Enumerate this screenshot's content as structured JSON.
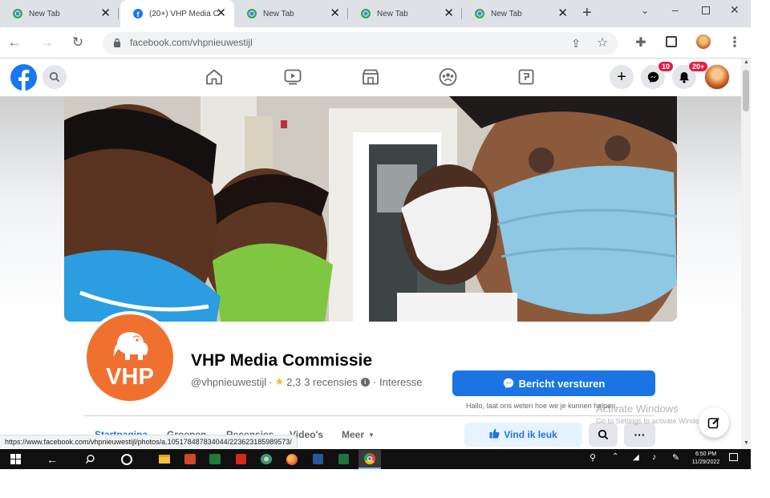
{
  "browser": {
    "tabs": [
      {
        "title": "New Tab"
      },
      {
        "title": "(20+) VHP Media C"
      },
      {
        "title": "New Tab"
      },
      {
        "title": "New Tab"
      },
      {
        "title": "New Tab"
      }
    ],
    "url": "facebook.com/vhpnieuwestijl"
  },
  "facebook": {
    "messenger_badge": "10",
    "notifications_badge": "20+"
  },
  "profile": {
    "logo_text": "VHP",
    "name": "VHP Media Commissie",
    "handle": "@vhpnieuwestijl",
    "rating": "2,3",
    "reviews": "3 recensies",
    "category": "Interesse",
    "message_button": "Bericht versturen",
    "message_hint": "Hallo, laat ons weten hoe we je kunnen helpen.",
    "like_button": "Vind ik leuk",
    "nav": [
      "Startpagina",
      "Groepen",
      "Recensies",
      "Video's",
      "Meer"
    ]
  },
  "watermark": {
    "title": "Activate Windows",
    "subtitle": "Go to Settings to activate Windows."
  },
  "status_url": "https://www.facebook.com/vhpnieuwestijl/photos/a.105178487834044/223623185989573/",
  "taskbar": {
    "time": "6:50 PM",
    "date": "11/29/2022"
  },
  "colors": {
    "facebook_blue": "#1b74e4",
    "vhp_orange": "#f07030",
    "tabstrip": "#dee1e6",
    "taskbar": "#101010",
    "badge_red": "#e41e3f"
  }
}
